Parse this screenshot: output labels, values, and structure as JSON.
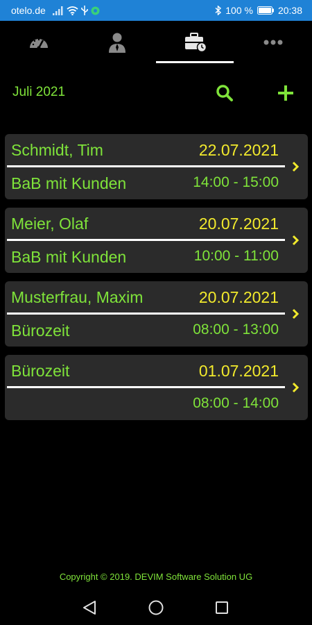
{
  "status_bar": {
    "carrier": "otelo.de",
    "battery": "100 %",
    "time": "20:38",
    "icons": [
      "signal-icon",
      "wifi-icon",
      "usb-icon",
      "vpn-icon",
      "bluetooth-icon",
      "battery-icon"
    ]
  },
  "tabs": [
    {
      "icon": "speedometer-icon"
    },
    {
      "icon": "person-icon"
    },
    {
      "icon": "briefcase-clock-icon",
      "active": true
    },
    {
      "icon": "more-dots-icon"
    }
  ],
  "header": {
    "month": "Juli 2021",
    "search_icon": "search-icon",
    "add_icon": "plus-icon"
  },
  "appointments": [
    {
      "name": "Schmidt, Tim",
      "date": "22.07.2021",
      "subject": "BaB mit Kunden",
      "time": "14:00 - 15:00"
    },
    {
      "name": "Meier, Olaf",
      "date": "20.07.2021",
      "subject": "BaB mit Kunden",
      "time": "10:00 - 11:00"
    },
    {
      "name": "Musterfrau, Maxim",
      "date": "20.07.2021",
      "subject": "Bürozeit",
      "time": "08:00 - 13:00"
    },
    {
      "name": "Bürozeit",
      "date": "01.07.2021",
      "subject": "",
      "time": "08:00 - 14:00"
    }
  ],
  "footer": {
    "copyright": "Copyright © 2019. DEVIM Software Solution UG"
  },
  "colors": {
    "accent_green": "#7fe33a",
    "date_yellow": "#f2ea2c",
    "status_bar_blue": "#1f82d6",
    "card_bg": "#2b2b2b"
  }
}
